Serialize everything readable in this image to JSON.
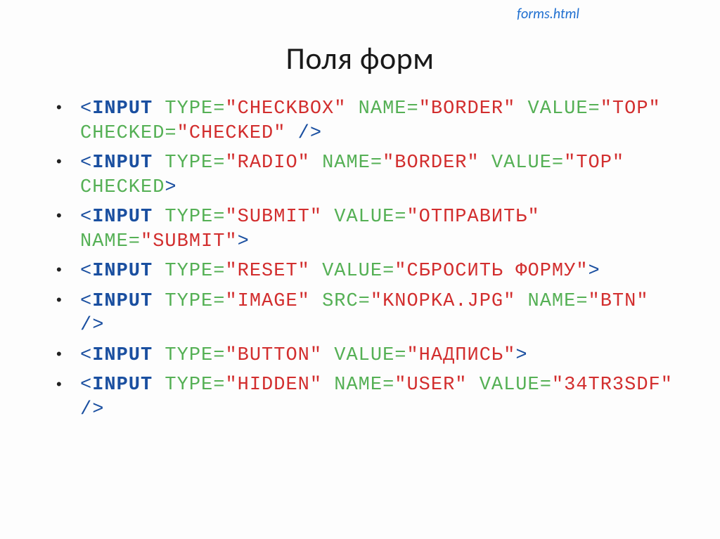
{
  "header_link": "forms.html",
  "title": "Поля форм",
  "items": [
    {
      "tag": "INPUT",
      "self_close": true,
      "attrs": [
        {
          "name": "TYPE",
          "value": "CHECKBOX"
        },
        {
          "name": "NAME",
          "value": "BORDER"
        },
        {
          "name": "VALUE",
          "value": "TOP"
        },
        {
          "name": "CHECKED",
          "value": "CHECKED"
        }
      ]
    },
    {
      "tag": "INPUT",
      "self_close": false,
      "attrs": [
        {
          "name": "TYPE",
          "value": "RADIO"
        },
        {
          "name": "NAME",
          "value": "BORDER"
        },
        {
          "name": "VALUE",
          "value": "TOP"
        },
        {
          "name": "CHECKED"
        }
      ]
    },
    {
      "tag": "INPUT",
      "self_close": false,
      "attrs": [
        {
          "name": "TYPE",
          "value": "SUBMIT"
        },
        {
          "name": "VALUE",
          "value": "ОТПРАВИТЬ"
        },
        {
          "name": "NAME",
          "value": "SUBMIT"
        }
      ]
    },
    {
      "tag": "INPUT",
      "self_close": false,
      "attrs": [
        {
          "name": "TYPE",
          "value": "RESET"
        },
        {
          "name": "VALUE",
          "value": "СБРОСИТЬ ФОРМУ"
        }
      ]
    },
    {
      "tag": "INPUT",
      "self_close": true,
      "attrs": [
        {
          "name": "TYPE",
          "value": "IMAGE"
        },
        {
          "name": "SRC",
          "value": "KNOPKA.JPG"
        },
        {
          "name": "NAME",
          "value": "BTN"
        }
      ]
    },
    {
      "tag": "INPUT",
      "self_close": false,
      "attrs": [
        {
          "name": "TYPE",
          "value": "BUTTON"
        },
        {
          "name": "VALUE",
          "value": "НАДПИСЬ"
        }
      ]
    },
    {
      "tag": "INPUT",
      "self_close": true,
      "attrs": [
        {
          "name": "TYPE",
          "value": "HIDDEN"
        },
        {
          "name": "NAME",
          "value": "USER"
        },
        {
          "name": "VALUE",
          "value": "34TR3SDF"
        }
      ]
    }
  ]
}
